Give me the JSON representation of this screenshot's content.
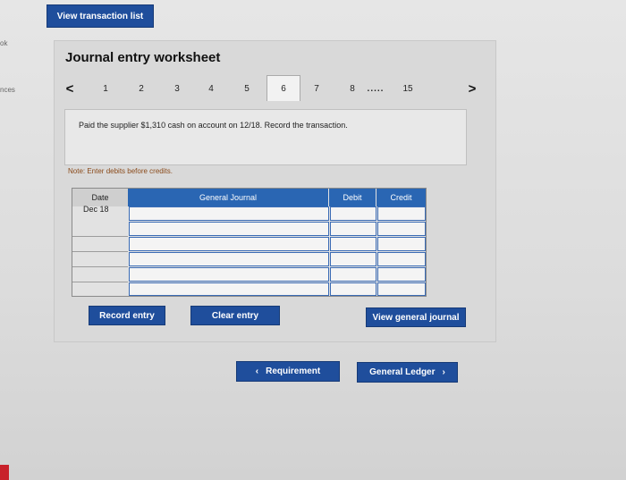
{
  "top": {
    "view_transaction_list": "View transaction list"
  },
  "edge": {
    "left_top": "ok",
    "left_mid": "nces"
  },
  "worksheet": {
    "title": "Journal entry worksheet",
    "tabs": [
      "1",
      "2",
      "3",
      "4",
      "5",
      "6",
      "7",
      "8",
      "15"
    ],
    "ellipsis": ".....",
    "active_tab": "6",
    "prev_arrow": "<",
    "next_arrow": ">"
  },
  "problem": {
    "text": "Paid the supplier $1,310 cash on account on 12/18. Record the transaction."
  },
  "note": "Note: Enter debits before credits.",
  "journal": {
    "headers": {
      "date": "Date",
      "account": "General Journal",
      "debit": "Debit",
      "credit": "Credit"
    },
    "rows": [
      {
        "date": "Dec 18",
        "account": "",
        "debit": "",
        "credit": ""
      },
      {
        "date": "",
        "account": "",
        "debit": "",
        "credit": ""
      },
      {
        "date": "",
        "account": "",
        "debit": "",
        "credit": ""
      },
      {
        "date": "",
        "account": "",
        "debit": "",
        "credit": ""
      },
      {
        "date": "",
        "account": "",
        "debit": "",
        "credit": ""
      },
      {
        "date": "",
        "account": "",
        "debit": "",
        "credit": ""
      }
    ]
  },
  "buttons": {
    "record_entry": "Record entry",
    "clear_entry": "Clear entry",
    "view_general_journal": "View general journal",
    "requirement": "Requirement",
    "general_ledger": "General Ledger",
    "requirement_icon": "chevron-left-icon",
    "general_ledger_icon": "chevron-right-icon"
  },
  "colors": {
    "button_blue": "#1f4e9c",
    "header_blue": "#2a66b3",
    "note": "#8a4a1a"
  }
}
